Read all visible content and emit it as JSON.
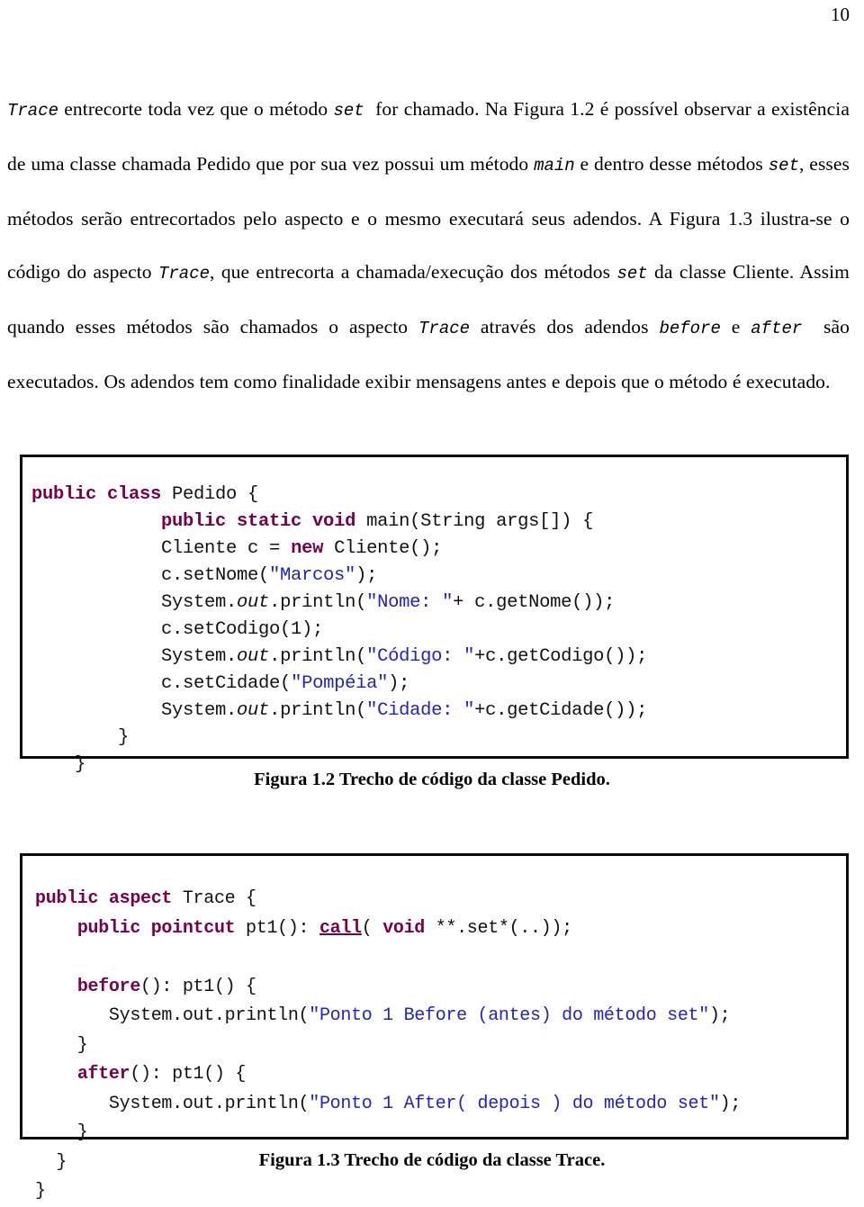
{
  "page": {
    "number": "10"
  },
  "body_text": {
    "paragraph_runs": [
      [
        {
          "t": "mono",
          "s": "Trace"
        },
        {
          "t": "text",
          "s": " entrecorte toda vez que o método "
        },
        {
          "t": "mono",
          "s": "set"
        },
        {
          "t": "text",
          "s": "  for chamado. Na Figura 1.2 é possível observar a existência de uma classe chamada Pedido que por sua vez possui um método "
        },
        {
          "t": "mono",
          "s": "main"
        },
        {
          "t": "text",
          "s": " e dentro desse métodos "
        },
        {
          "t": "mono",
          "s": "set"
        },
        {
          "t": "text",
          "s": ", esses métodos serão entrecortados pelo aspecto e o mesmo executará seus adendos. A Figura 1.3 ilustra-se o código do aspecto "
        },
        {
          "t": "mono",
          "s": "Trace"
        },
        {
          "t": "text",
          "s": ", que entrecorta a chamada/execução dos métodos "
        },
        {
          "t": "mono",
          "s": "set"
        },
        {
          "t": "text",
          "s": " da classe Cliente. Assim quando esses métodos são chamados o aspecto "
        },
        {
          "t": "mono",
          "s": "Trace"
        },
        {
          "t": "text",
          "s": " através dos adendos "
        },
        {
          "t": "mono",
          "s": "before"
        },
        {
          "t": "text",
          "s": " e "
        },
        {
          "t": "mono",
          "s": "after"
        },
        {
          "t": "text",
          "s": "  são executados. Os adendos tem como finalidade exibir mensagens antes e depois que o método é executado."
        }
      ]
    ],
    "plain": "Trace entrecorte toda vez que o método set for chamado. Na Figura 1.2 é possível observar a existência de uma classe chamada Pedido que por sua vez possui um método main e dentro desse métodos set, esses métodos serão entrecortados pelo aspecto e o mesmo executará seus adendos. A Figura 1.3 ilustra-se o código do aspecto Trace, que entrecorta a chamada/execução dos métodos set da classe Cliente. Assim quando esses métodos são chamados o aspecto Trace através dos adendos before e after são executados. Os adendos tem como finalidade exibir mensagens antes e depois que o método é executado."
  },
  "figures": [
    {
      "id": "figura-1-2",
      "caption": "Figura 1.2 Trecho de código da classe Pedido.",
      "language": "java",
      "code_lines": [
        "public class Pedido {",
        "            public static void main(String args[]) {",
        "            Cliente c = new Cliente();",
        "            c.setNome(\"Marcos\");",
        "            System.out.println(\"Nome: \"+ c.getNome());",
        "            c.setCodigo(1);",
        "            System.out.println(\"Código: \"+c.getCodigo());",
        "            c.setCidade(\"Pompéia\");",
        "            System.out.println(\"Cidade: \"+c.getCidade());",
        "        }",
        "    }"
      ]
    },
    {
      "id": "figura-1-3",
      "caption": "Figura 1.3 Trecho de  código da classe Trace.",
      "language": "aspectj",
      "code_lines": [
        "public aspect Trace {",
        "    public pointcut pt1(): call( void **.set*(..));",
        "",
        "    before(): pt1() {",
        "       System.out.println(\"Ponto 1 Before (antes) do método set\");",
        "    }",
        "    after(): pt1() {",
        "       System.out.println(\"Ponto 1 After( depois ) do método set\");",
        "    }",
        "  }",
        "}"
      ]
    }
  ],
  "colors": {
    "keyword": "#78004a",
    "string": "#2222c8",
    "text": "#111111",
    "border": "#0a0a0a",
    "background": "#ffffff"
  }
}
